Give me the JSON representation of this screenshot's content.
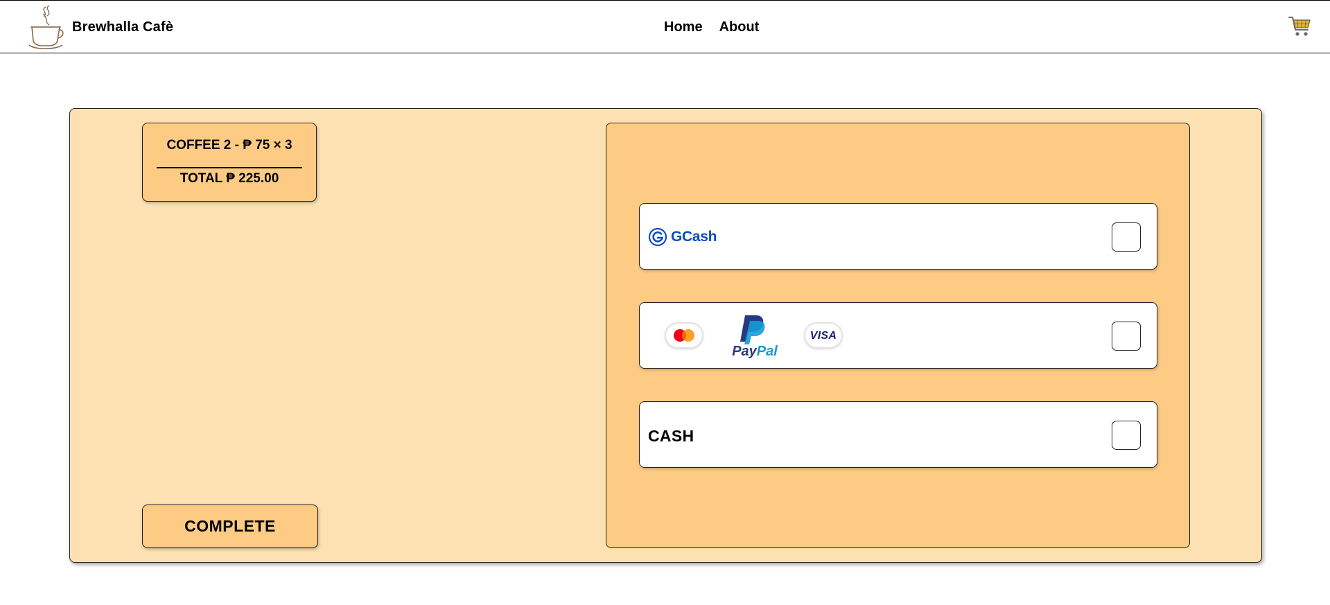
{
  "header": {
    "brand_name": "Brewhalla Cafè",
    "nav": {
      "home": "Home",
      "about": "About"
    },
    "icons": {
      "logo": "coffee-cup-logo",
      "cart": "shopping-cart-icon"
    }
  },
  "order": {
    "item_line": "COFFEE 2 - ₱ 75 × 3",
    "total_line": "TOTAL ₱ 225.00"
  },
  "actions": {
    "complete_label": "COMPLETE"
  },
  "payment_methods": [
    {
      "id": "gcash",
      "label": "GCash",
      "checked": false
    },
    {
      "id": "card-paypal",
      "logos": [
        "mastercard-logo",
        "paypal-logo",
        "visa-logo"
      ],
      "paypal_text": "PayPal",
      "visa_text": "VISA",
      "checked": false
    },
    {
      "id": "cash",
      "label": "CASH",
      "checked": false
    }
  ],
  "colors": {
    "panel_bg": "#fde1b3",
    "accent_bg": "#fecb85",
    "gcash_blue": "#0b4dbd",
    "paypal_dark": "#253b80",
    "paypal_light": "#179bd7",
    "visa_blue": "#1a1f71",
    "cart_gold": "#f0b323"
  }
}
